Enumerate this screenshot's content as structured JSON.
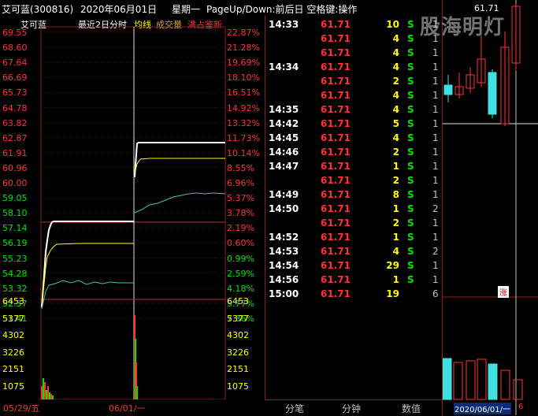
{
  "header": {
    "stock": "艾可蓝(300816)",
    "date": "2020年06月01日",
    "weekday": "星期一",
    "hint": "PageUp/Down:前后日 空格键:操作"
  },
  "legend": {
    "name": "艾可蓝",
    "mode": "最近2日分时",
    "avg": "均线",
    "volume": "成交量",
    "limit": "满占鉴新"
  },
  "price_axis": {
    "left": [
      "69.55",
      "68.60",
      "67.64",
      "66.69",
      "65.73",
      "64.78",
      "63.82",
      "62.87",
      "61.91",
      "60.96",
      "60.00",
      "59.05",
      "58.10",
      "57.14",
      "56.19",
      "55.23",
      "54.28",
      "53.32",
      "52.37",
      "51.41"
    ],
    "right": [
      "22.87%",
      "21.28%",
      "19.69%",
      "18.10%",
      "16.51%",
      "14.92%",
      "13.32%",
      "11.73%",
      "10.14%",
      "8.55%",
      "6.96%",
      "5.37%",
      "3.78%",
      "2.19%",
      "0.60%",
      "0.99%",
      "2.59%",
      "4.18%",
      "5.77%",
      "7.36%"
    ]
  },
  "volume_axis": [
    "6453",
    "5377",
    "4302",
    "3226",
    "2151",
    "1075"
  ],
  "dates": [
    "05/29/五",
    "06/01/一"
  ],
  "ticks": [
    {
      "time": "14:33",
      "price": "61.71",
      "vol": "10",
      "side": "S",
      "n": "1"
    },
    {
      "time": "",
      "price": "61.71",
      "vol": "4",
      "side": "S",
      "n": "1"
    },
    {
      "time": "",
      "price": "61.71",
      "vol": "4",
      "side": "S",
      "n": "1"
    },
    {
      "time": "14:34",
      "price": "61.71",
      "vol": "4",
      "side": "S",
      "n": "1"
    },
    {
      "time": "",
      "price": "61.71",
      "vol": "2",
      "side": "S",
      "n": "1"
    },
    {
      "time": "",
      "price": "61.71",
      "vol": "4",
      "side": "S",
      "n": "1"
    },
    {
      "time": "14:35",
      "price": "61.71",
      "vol": "4",
      "side": "S",
      "n": "1"
    },
    {
      "time": "14:42",
      "price": "61.71",
      "vol": "5",
      "side": "S",
      "n": "1"
    },
    {
      "time": "14:45",
      "price": "61.71",
      "vol": "4",
      "side": "S",
      "n": "1"
    },
    {
      "time": "14:46",
      "price": "61.71",
      "vol": "2",
      "side": "S",
      "n": "1"
    },
    {
      "time": "14:47",
      "price": "61.71",
      "vol": "1",
      "side": "S",
      "n": "1"
    },
    {
      "time": "",
      "price": "61.71",
      "vol": "2",
      "side": "S",
      "n": "1"
    },
    {
      "time": "14:49",
      "price": "61.71",
      "vol": "8",
      "side": "S",
      "n": "1"
    },
    {
      "time": "14:50",
      "price": "61.71",
      "vol": "1",
      "side": "S",
      "n": "2"
    },
    {
      "time": "",
      "price": "61.71",
      "vol": "2",
      "side": "S",
      "n": "1"
    },
    {
      "time": "14:52",
      "price": "61.71",
      "vol": "1",
      "side": "S",
      "n": "1"
    },
    {
      "time": "14:53",
      "price": "61.71",
      "vol": "4",
      "side": "S",
      "n": "2"
    },
    {
      "time": "14:54",
      "price": "61.71",
      "vol": "29",
      "side": "S",
      "n": "1"
    },
    {
      "time": "14:56",
      "price": "61.71",
      "vol": "1",
      "side": "S",
      "n": "1"
    },
    {
      "time": "15:00",
      "price": "61.71",
      "vol": "19",
      "side": "",
      "n": "6"
    }
  ],
  "tabs": [
    "分笔",
    "分钟",
    "数值"
  ],
  "side_panel": {
    "price": "61.71",
    "badge": "涨",
    "date": "2020/06/01/一",
    "count": "6"
  },
  "watermark": "股海明灯",
  "colors": {
    "up": "#ff3232",
    "down": "#00e600",
    "price_line": "#ffffff",
    "avg_line": "#ffff00",
    "volume_line": "#40c0c0"
  }
}
